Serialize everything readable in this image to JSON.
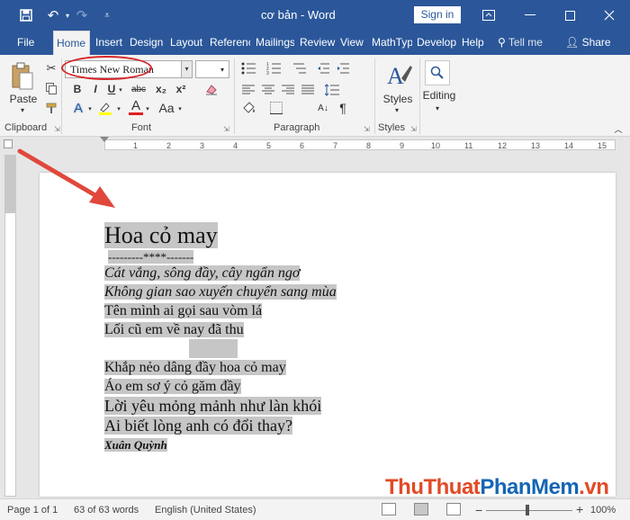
{
  "window": {
    "title": "cơ bản - Word",
    "sign_in": "Sign in",
    "undo_symbol": "↶",
    "redo_symbol": "↷"
  },
  "tabs": [
    {
      "label": "File",
      "active": false
    },
    {
      "label": "Home",
      "active": true
    },
    {
      "label": "Insert",
      "active": false
    },
    {
      "label": "Design",
      "active": false
    },
    {
      "label": "Layout",
      "active": false
    },
    {
      "label": "Referenc",
      "active": false
    },
    {
      "label": "Mailings",
      "active": false
    },
    {
      "label": "Review",
      "active": false
    },
    {
      "label": "View",
      "active": false
    },
    {
      "label": "MathTyp",
      "active": false
    },
    {
      "label": "Develop",
      "active": false
    },
    {
      "label": "Help",
      "active": false
    }
  ],
  "tell_me": "Tell me",
  "share": "Share",
  "ribbon": {
    "clipboard": {
      "label": "Clipboard",
      "paste": "Paste"
    },
    "font": {
      "label": "Font",
      "font_name": "Times New Roman",
      "font_size": "",
      "bold": "B",
      "italic": "I",
      "underline": "U",
      "strike": "abc",
      "subscript": "x₂",
      "superscript": "x²",
      "grow": "A",
      "text_effects": "A",
      "highlight": "ab",
      "font_color": "A",
      "change_case": "Aa",
      "font_color_hex": "#e02020",
      "highlight_hex": "#ffff00"
    },
    "paragraph": {
      "label": "Paragraph"
    },
    "styles": {
      "label": "Styles",
      "button": "Styles"
    },
    "editing": {
      "button": "Editing"
    }
  },
  "ruler_numbers": [
    "1",
    "2",
    "3",
    "4",
    "5",
    "6",
    "7",
    "8",
    "9",
    "10",
    "11",
    "12",
    "13",
    "14",
    "15"
  ],
  "document": {
    "lines": [
      {
        "text": "Hoa cỏ may ",
        "style": "title"
      },
      {
        "text": "---------****-------",
        "style": "small"
      },
      {
        "text": "Cát vắng, sông đầy, cây ngẩn ngơ",
        "style": "mid-italic"
      },
      {
        "text": "Không gian sao xuyến chuyển sang mùa",
        "style": "mid-italic"
      },
      {
        "text": "Tên mình ai gọi sau vòm lá",
        "style": "mid"
      },
      {
        "text": "Lối cũ em về nay đã thu",
        "style": "mid"
      },
      {
        "text": "",
        "style": "blank"
      },
      {
        "text": "Khắp nẻo dâng đầy hoa cỏ may",
        "style": "mid"
      },
      {
        "text": "Áo em sơ ý cỏ găm đầy",
        "style": "mid"
      },
      {
        "text": "Lời yêu mỏng mảnh như làn khói",
        "style": "big"
      },
      {
        "text": "Ai biết lòng anh có đổi thay?",
        "style": "big"
      },
      {
        "text": "Xuân Quỳnh",
        "style": "signature"
      }
    ]
  },
  "status": {
    "page": "Page 1 of 1",
    "words": "63 of 63 words",
    "language": "English (United States)",
    "zoom_minus": "−",
    "zoom_plus": "+",
    "zoom": "100%",
    "zoom_level": 0.5
  },
  "watermark": {
    "part1": "ThuThuat",
    "part2": "PhanMem",
    "part3": ".vn"
  }
}
